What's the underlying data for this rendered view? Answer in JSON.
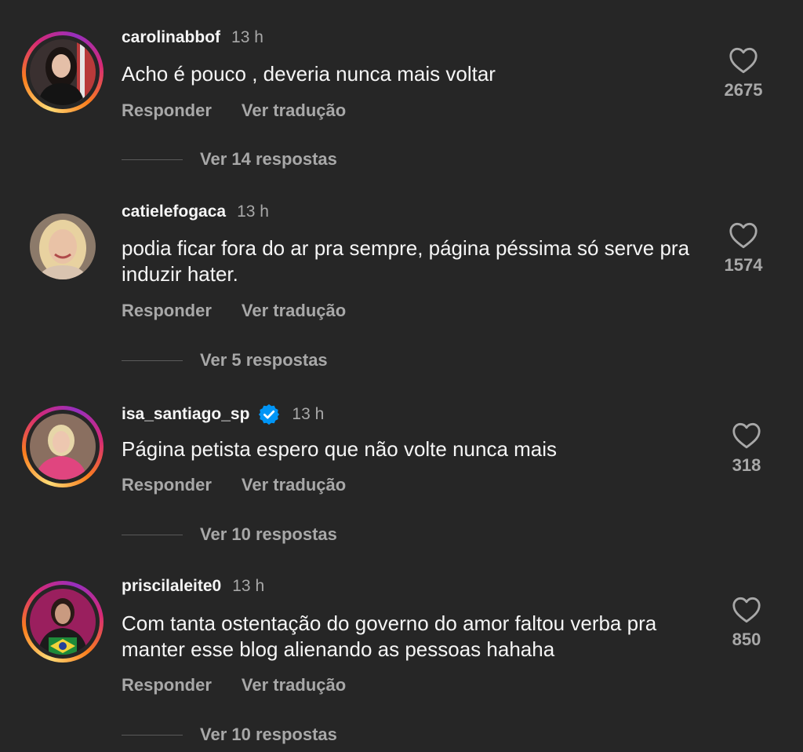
{
  "comments": [
    {
      "username": "carolinabbof",
      "time": "13 h",
      "text": "Acho é  pouco , deveria nunca mais voltar",
      "reply_label": "Responder",
      "translate_label": "Ver tradução",
      "view_replies": "Ver 14 respostas",
      "likes": "2675",
      "verified": false
    },
    {
      "username": "catielefogaca",
      "time": "13 h",
      "text": "podia ficar fora do ar pra sempre, página péssima só serve pra induzir hater.",
      "reply_label": "Responder",
      "translate_label": "Ver tradução",
      "view_replies": "Ver 5 respostas",
      "likes": "1574",
      "verified": false
    },
    {
      "username": "isa_santiago_sp",
      "time": "13 h",
      "text": "Página petista espero que não volte nunca mais",
      "reply_label": "Responder",
      "translate_label": "Ver tradução",
      "view_replies": "Ver 10 respostas",
      "likes": "318",
      "verified": true
    },
    {
      "username": "priscilaleite0",
      "time": "13 h",
      "text": "Com tanta ostentação do governo do amor faltou verba pra manter esse blog alienando as pessoas hahaha",
      "reply_label": "Responder",
      "translate_label": "Ver tradução",
      "view_replies": "Ver 10 respostas",
      "likes": "850",
      "verified": false
    }
  ],
  "icons": {
    "like": "heart-outline-icon",
    "verified": "verified-badge-icon"
  },
  "colors": {
    "background": "#262626",
    "primary_text": "#f5f5f5",
    "secondary_text": "#a8a8a8",
    "verified_blue": "#0095f6"
  }
}
